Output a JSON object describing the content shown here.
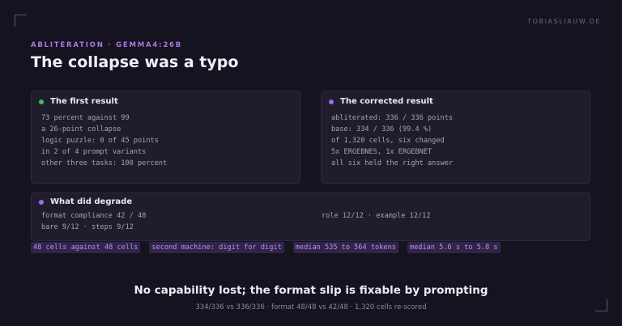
{
  "site": "TOBIASLIAUW.DE",
  "eyebrow": "ABLITERATION · GEMMA4:26B",
  "title": "The collapse was a typo",
  "colors": {
    "green_dot": "#3fbf5f",
    "purple_dot": "#a56be8",
    "accent": "#a879e0"
  },
  "cards": {
    "first": {
      "heading": "The first result",
      "lines": [
        "73 percent against 99",
        "a 26-point collapse",
        "logic puzzle: 0 of 45 points",
        "in 2 of 4 prompt variants",
        "other three tasks: 100 percent"
      ]
    },
    "corrected": {
      "heading": "The corrected result",
      "lines": [
        "abliterated: 336 / 336 points",
        "base: 334 / 336 (99.4 %)",
        "of 1,320 cells, six changed",
        "5x ERGEBNES, 1x ERGEBNET",
        "all six held the right answer"
      ]
    },
    "degrade": {
      "heading": "What did degrade",
      "left_lines": [
        "format compliance 42 / 48",
        "bare 9/12 · steps 9/12"
      ],
      "right_lines": [
        "role 12/12 · example 12/12"
      ]
    }
  },
  "tags": [
    "48 cells against 48 cells",
    "second machine: digit for digit",
    "median 535 to 564 tokens",
    "median 5.6 s to 5.8 s"
  ],
  "bottom": {
    "title": "No capability lost; the format slip is fixable by prompting",
    "subtitle": "334/336 vs 336/336 · format 48/48 vs 42/48 · 1,320 cells re-scored"
  }
}
